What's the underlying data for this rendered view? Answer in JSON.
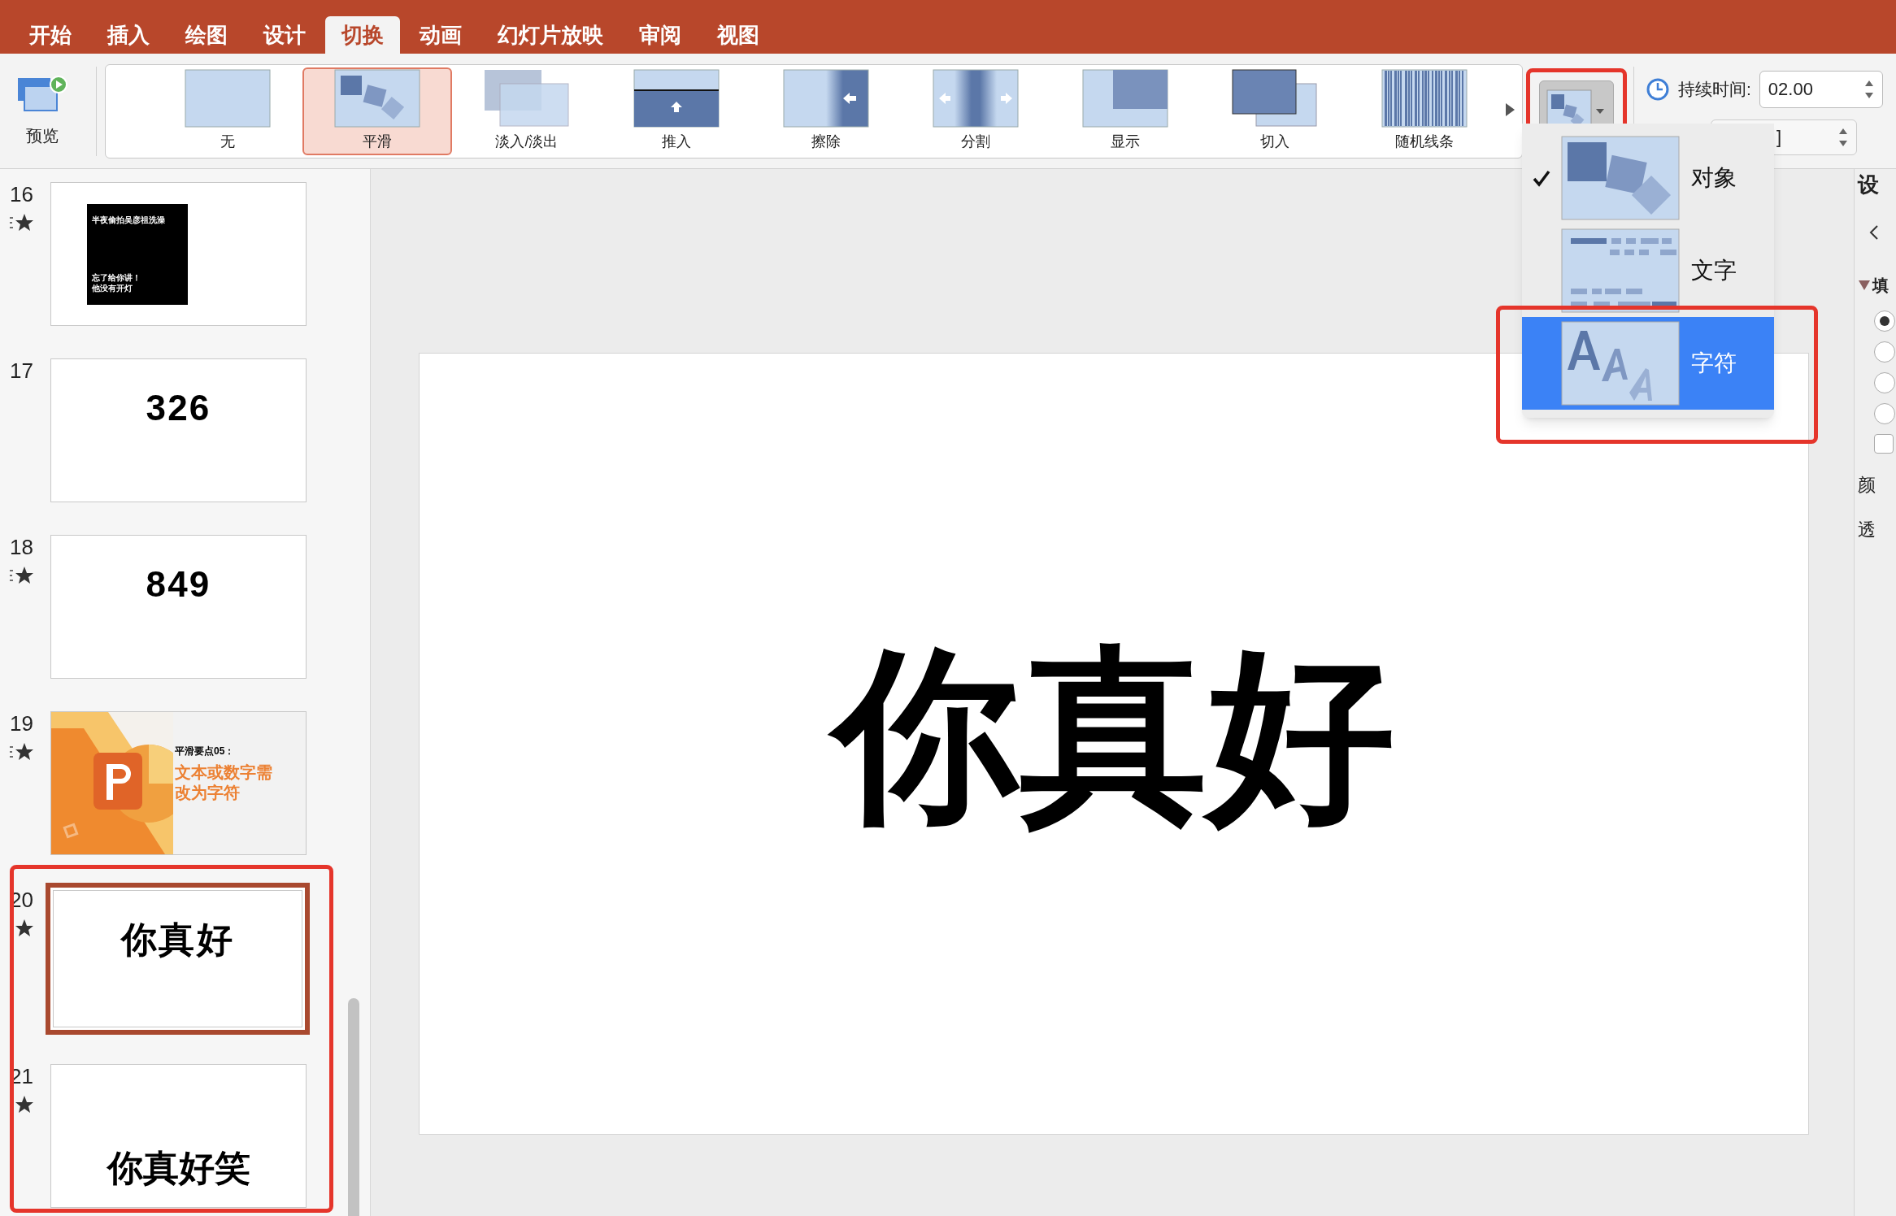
{
  "ribbon_tabs": [
    {
      "label": "开始",
      "selected": false
    },
    {
      "label": "插入",
      "selected": false
    },
    {
      "label": "绘图",
      "selected": false
    },
    {
      "label": "设计",
      "selected": false
    },
    {
      "label": "切换",
      "selected": true
    },
    {
      "label": "动画",
      "selected": false
    },
    {
      "label": "幻灯片放映",
      "selected": false
    },
    {
      "label": "审阅",
      "selected": false
    },
    {
      "label": "视图",
      "selected": false
    }
  ],
  "preview_button": {
    "label": "预览"
  },
  "transitions": [
    {
      "label": "无",
      "kind": "none",
      "selected": false
    },
    {
      "label": "平滑",
      "kind": "morph",
      "selected": true
    },
    {
      "label": "淡入/淡出",
      "kind": "fade",
      "selected": false
    },
    {
      "label": "推入",
      "kind": "push",
      "selected": false
    },
    {
      "label": "擦除",
      "kind": "wipe",
      "selected": false
    },
    {
      "label": "分割",
      "kind": "split",
      "selected": false
    },
    {
      "label": "显示",
      "kind": "reveal",
      "selected": false
    },
    {
      "label": "切入",
      "kind": "cut",
      "selected": false
    },
    {
      "label": "随机线条",
      "kind": "bars",
      "selected": false
    }
  ],
  "duration": {
    "label": "持续时间:",
    "value": "02.00"
  },
  "sound_select": {
    "value": "]"
  },
  "effect_menu": [
    {
      "label": "对象",
      "kind": "objects",
      "checked": true,
      "selected": false
    },
    {
      "label": "文字",
      "kind": "words",
      "checked": false,
      "selected": false
    },
    {
      "label": "字符",
      "kind": "characters",
      "checked": false,
      "selected": true
    }
  ],
  "slides": [
    {
      "number": "16",
      "animated": true,
      "selected": false,
      "kind": "black_card",
      "texts": [
        "半夜偷拍吴彦祖洗澡",
        "忘了给你讲！",
        "他没有开灯"
      ]
    },
    {
      "number": "17",
      "animated": false,
      "selected": false,
      "kind": "title",
      "texts": [
        "326"
      ]
    },
    {
      "number": "18",
      "animated": true,
      "selected": false,
      "kind": "title",
      "texts": [
        "849"
      ]
    },
    {
      "number": "19",
      "animated": true,
      "selected": false,
      "kind": "cover",
      "texts": [
        "平滑要点05：",
        "文本或数字需",
        "改为字符"
      ]
    },
    {
      "number": "20",
      "animated": true,
      "selected": true,
      "kind": "title",
      "texts": [
        "你真好"
      ]
    },
    {
      "number": "21",
      "animated": true,
      "selected": false,
      "kind": "bottom_title",
      "texts": [
        "你真好笑"
      ]
    }
  ],
  "current_slide": {
    "text": "你真好"
  },
  "format_pane": {
    "title": "设",
    "section": "填",
    "labels": [
      "颜",
      "透"
    ],
    "radios": [
      {
        "selected": true
      },
      {
        "selected": false
      },
      {
        "selected": false
      },
      {
        "selected": false
      }
    ],
    "checkbox": {
      "checked": false
    }
  }
}
